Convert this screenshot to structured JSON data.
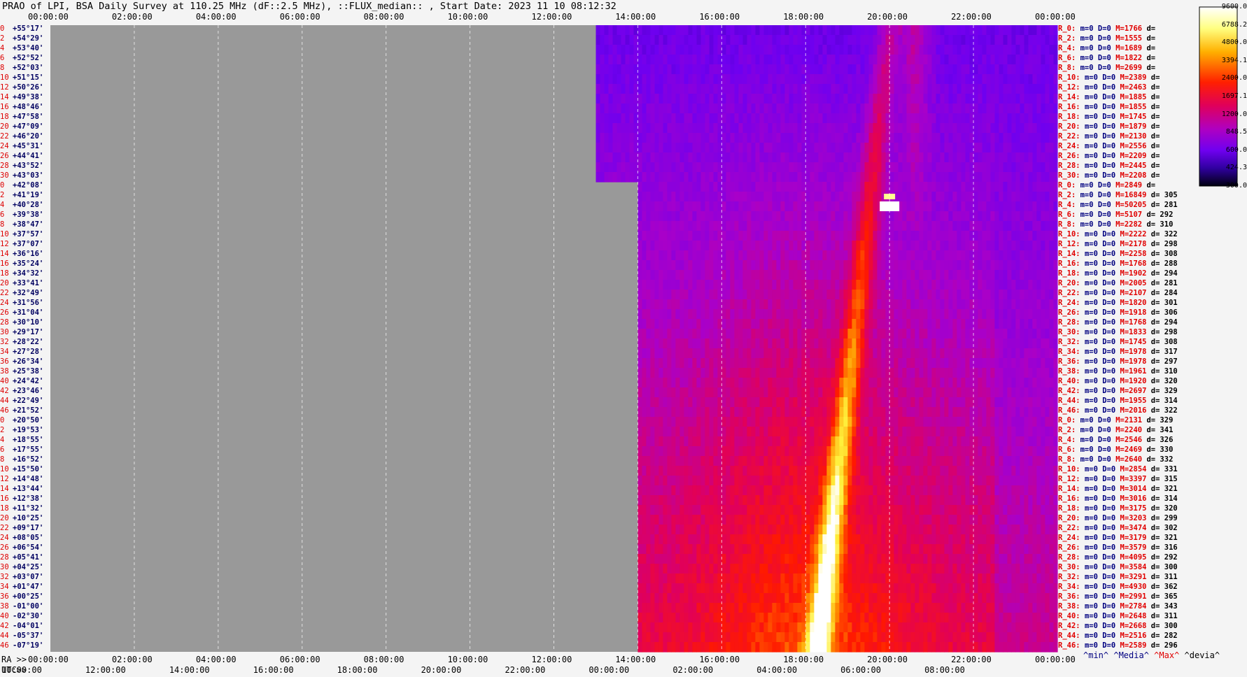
{
  "title": "PRAO of LPI, BSA Daily Survey at 110.25 MHz (dF::2.5 MHz), ::FLUX_median:: , Start Date: 2023 11 10 08:12:32",
  "footer": {
    "ra_prefix": "RA >>",
    "utc_prefix": "UTC>>"
  },
  "legend": {
    "min": "^min^",
    "median": "^Media^",
    "max": "^Max^",
    "devia": "^devia^"
  },
  "colors": {
    "background": "#999999",
    "panel": "#f4f4f4",
    "grid": "#ffffff"
  },
  "chart_data": {
    "type": "heatmap",
    "title": "PRAO of LPI, BSA Daily Survey at 110.25 MHz (dF::2.5 MHz), ::FLUX_median:: , Start Date: 2023 11 10 08:12:32",
    "x_range_hours": [
      0,
      24
    ],
    "data_start_hours": 14.0,
    "data_start_hours_upper_block": 13.0,
    "upper_block_rows": 16,
    "top_ticks": [
      "00:00:00",
      "02:00:00",
      "04:00:00",
      "06:00:00",
      "08:00:00",
      "10:00:00",
      "12:00:00",
      "14:00:00",
      "16:00:00",
      "18:00:00",
      "20:00:00",
      "22:00:00",
      "00:00:00"
    ],
    "bottom_ra_ticks": [
      "00:00:00",
      "02:00:00",
      "04:00:00",
      "06:00:00",
      "08:00:00",
      "10:00:00",
      "12:00:00",
      "14:00:00",
      "16:00:00",
      "18:00:00",
      "20:00:00",
      "22:00:00",
      "00:00:00"
    ],
    "bottom_utc_ticks": [
      "10:00:00",
      "12:00:00",
      "14:00:00",
      "16:00:00",
      "18:00:00",
      "20:00:00",
      "22:00:00",
      "00:00:00",
      "02:00:00",
      "04:00:00",
      "06:00:00",
      "08:00:00"
    ],
    "colorbar": {
      "labels": [
        "9600.0",
        "6788.2",
        "4800.0",
        "3394.1",
        "2400.0",
        "1697.1",
        "1200.0",
        "848.5",
        "600.0",
        "424.3",
        "300.0"
      ]
    },
    "rows": [
      {
        "i": "0",
        "dec": "+55°17'",
        "r": "R_0:",
        "m": "0",
        "D": "0",
        "M": "1766",
        "d": ""
      },
      {
        "i": "2",
        "dec": "+54°29'",
        "r": "R_2:",
        "m": "0",
        "D": "0",
        "M": "1555",
        "d": ""
      },
      {
        "i": "4",
        "dec": "+53°40'",
        "r": "R_4:",
        "m": "0",
        "D": "0",
        "M": "1689",
        "d": ""
      },
      {
        "i": "6",
        "dec": "+52°52'",
        "r": "R_6:",
        "m": "0",
        "D": "0",
        "M": "1822",
        "d": ""
      },
      {
        "i": "8",
        "dec": "+52°03'",
        "r": "R_8:",
        "m": "0",
        "D": "0",
        "M": "2699",
        "d": ""
      },
      {
        "i": "10",
        "dec": "+51°15'",
        "r": "R_10:",
        "m": "0",
        "D": "0",
        "M": "2389",
        "d": ""
      },
      {
        "i": "12",
        "dec": "+50°26'",
        "r": "R_12:",
        "m": "0",
        "D": "0",
        "M": "2463",
        "d": ""
      },
      {
        "i": "14",
        "dec": "+49°38'",
        "r": "R_14:",
        "m": "0",
        "D": "0",
        "M": "1885",
        "d": ""
      },
      {
        "i": "16",
        "dec": "+48°46'",
        "r": "R_16:",
        "m": "0",
        "D": "0",
        "M": "1855",
        "d": ""
      },
      {
        "i": "18",
        "dec": "+47°58'",
        "r": "R_18:",
        "m": "0",
        "D": "0",
        "M": "1745",
        "d": ""
      },
      {
        "i": "20",
        "dec": "+47°09'",
        "r": "R_20:",
        "m": "0",
        "D": "0",
        "M": "1879",
        "d": ""
      },
      {
        "i": "22",
        "dec": "+46°20'",
        "r": "R_22:",
        "m": "0",
        "D": "0",
        "M": "2130",
        "d": ""
      },
      {
        "i": "24",
        "dec": "+45°31'",
        "r": "R_24:",
        "m": "0",
        "D": "0",
        "M": "2556",
        "d": ""
      },
      {
        "i": "26",
        "dec": "+44°41'",
        "r": "R_26:",
        "m": "0",
        "D": "0",
        "M": "2209",
        "d": ""
      },
      {
        "i": "28",
        "dec": "+43°52'",
        "r": "R_28:",
        "m": "0",
        "D": "0",
        "M": "2445",
        "d": ""
      },
      {
        "i": "30",
        "dec": "+43°03'",
        "r": "R_30:",
        "m": "0",
        "D": "0",
        "M": "2208",
        "d": ""
      },
      {
        "i": "0",
        "dec": "+42°08'",
        "r": "R_0:",
        "m": "0",
        "D": "0",
        "M": "2849",
        "d": ""
      },
      {
        "i": "2",
        "dec": "+41°19'",
        "r": "R_2:",
        "m": "0",
        "D": "0",
        "M": "16849",
        "d": "305"
      },
      {
        "i": "4",
        "dec": "+40°28'",
        "r": "R_4:",
        "m": "0",
        "D": "0",
        "M": "50205",
        "d": "281"
      },
      {
        "i": "6",
        "dec": "+39°38'",
        "r": "R_6:",
        "m": "0",
        "D": "0",
        "M": "5107",
        "d": "292"
      },
      {
        "i": "8",
        "dec": "+38°47'",
        "r": "R_8:",
        "m": "0",
        "D": "0",
        "M": "2282",
        "d": "310"
      },
      {
        "i": "10",
        "dec": "+37°57'",
        "r": "R_10:",
        "m": "0",
        "D": "0",
        "M": "2222",
        "d": "322"
      },
      {
        "i": "12",
        "dec": "+37°07'",
        "r": "R_12:",
        "m": "0",
        "D": "0",
        "M": "2178",
        "d": "298"
      },
      {
        "i": "14",
        "dec": "+36°16'",
        "r": "R_14:",
        "m": "0",
        "D": "0",
        "M": "2258",
        "d": "308"
      },
      {
        "i": "16",
        "dec": "+35°24'",
        "r": "R_16:",
        "m": "0",
        "D": "0",
        "M": "1768",
        "d": "288"
      },
      {
        "i": "18",
        "dec": "+34°32'",
        "r": "R_18:",
        "m": "0",
        "D": "0",
        "M": "1902",
        "d": "294"
      },
      {
        "i": "20",
        "dec": "+33°41'",
        "r": "R_20:",
        "m": "0",
        "D": "0",
        "M": "2005",
        "d": "281"
      },
      {
        "i": "22",
        "dec": "+32°49'",
        "r": "R_22:",
        "m": "0",
        "D": "0",
        "M": "2107",
        "d": "284"
      },
      {
        "i": "24",
        "dec": "+31°56'",
        "r": "R_24:",
        "m": "0",
        "D": "0",
        "M": "1820",
        "d": "301"
      },
      {
        "i": "26",
        "dec": "+31°04'",
        "r": "R_26:",
        "m": "0",
        "D": "0",
        "M": "1918",
        "d": "306"
      },
      {
        "i": "28",
        "dec": "+30°10'",
        "r": "R_28:",
        "m": "0",
        "D": "0",
        "M": "1768",
        "d": "294"
      },
      {
        "i": "30",
        "dec": "+29°17'",
        "r": "R_30:",
        "m": "0",
        "D": "0",
        "M": "1833",
        "d": "298"
      },
      {
        "i": "32",
        "dec": "+28°22'",
        "r": "R_32:",
        "m": "0",
        "D": "0",
        "M": "1745",
        "d": "308"
      },
      {
        "i": "34",
        "dec": "+27°28'",
        "r": "R_34:",
        "m": "0",
        "D": "0",
        "M": "1978",
        "d": "317"
      },
      {
        "i": "36",
        "dec": "+26°34'",
        "r": "R_36:",
        "m": "0",
        "D": "0",
        "M": "1978",
        "d": "297"
      },
      {
        "i": "38",
        "dec": "+25°38'",
        "r": "R_38:",
        "m": "0",
        "D": "0",
        "M": "1961",
        "d": "310"
      },
      {
        "i": "40",
        "dec": "+24°42'",
        "r": "R_40:",
        "m": "0",
        "D": "0",
        "M": "1920",
        "d": "320"
      },
      {
        "i": "42",
        "dec": "+23°46'",
        "r": "R_42:",
        "m": "0",
        "D": "0",
        "M": "2697",
        "d": "329"
      },
      {
        "i": "44",
        "dec": "+22°49'",
        "r": "R_44:",
        "m": "0",
        "D": "0",
        "M": "1955",
        "d": "314"
      },
      {
        "i": "46",
        "dec": "+21°52'",
        "r": "R_46:",
        "m": "0",
        "D": "0",
        "M": "2016",
        "d": "322"
      },
      {
        "i": "0",
        "dec": "+20°50'",
        "r": "R_0:",
        "m": "0",
        "D": "0",
        "M": "2131",
        "d": "329"
      },
      {
        "i": "2",
        "dec": "+19°53'",
        "r": "R_2:",
        "m": "0",
        "D": "0",
        "M": "2240",
        "d": "341"
      },
      {
        "i": "4",
        "dec": "+18°55'",
        "r": "R_4:",
        "m": "0",
        "D": "0",
        "M": "2546",
        "d": "326"
      },
      {
        "i": "6",
        "dec": "+17°55'",
        "r": "R_6:",
        "m": "0",
        "D": "0",
        "M": "2469",
        "d": "330"
      },
      {
        "i": "8",
        "dec": "+16°52'",
        "r": "R_8:",
        "m": "0",
        "D": "0",
        "M": "2640",
        "d": "332"
      },
      {
        "i": "10",
        "dec": "+15°50'",
        "r": "R_10:",
        "m": "0",
        "D": "0",
        "M": "2854",
        "d": "331"
      },
      {
        "i": "12",
        "dec": "+14°48'",
        "r": "R_12:",
        "m": "0",
        "D": "0",
        "M": "3397",
        "d": "315"
      },
      {
        "i": "14",
        "dec": "+13°44'",
        "r": "R_14:",
        "m": "0",
        "D": "0",
        "M": "3014",
        "d": "321"
      },
      {
        "i": "16",
        "dec": "+12°38'",
        "r": "R_16:",
        "m": "0",
        "D": "0",
        "M": "3016",
        "d": "314"
      },
      {
        "i": "18",
        "dec": "+11°32'",
        "r": "R_18:",
        "m": "0",
        "D": "0",
        "M": "3175",
        "d": "320"
      },
      {
        "i": "20",
        "dec": "+10°25'",
        "r": "R_20:",
        "m": "0",
        "D": "0",
        "M": "3203",
        "d": "299"
      },
      {
        "i": "22",
        "dec": "+09°17'",
        "r": "R_22:",
        "m": "0",
        "D": "0",
        "M": "3474",
        "d": "302"
      },
      {
        "i": "24",
        "dec": "+08°05'",
        "r": "R_24:",
        "m": "0",
        "D": "0",
        "M": "3179",
        "d": "321"
      },
      {
        "i": "26",
        "dec": "+06°54'",
        "r": "R_26:",
        "m": "0",
        "D": "0",
        "M": "3579",
        "d": "316"
      },
      {
        "i": "28",
        "dec": "+05°41'",
        "r": "R_28:",
        "m": "0",
        "D": "0",
        "M": "4095",
        "d": "292"
      },
      {
        "i": "30",
        "dec": "+04°25'",
        "r": "R_30:",
        "m": "0",
        "D": "0",
        "M": "3584",
        "d": "300"
      },
      {
        "i": "32",
        "dec": "+03°07'",
        "r": "R_32:",
        "m": "0",
        "D": "0",
        "M": "3291",
        "d": "311"
      },
      {
        "i": "34",
        "dec": "+01°47'",
        "r": "R_34:",
        "m": "0",
        "D": "0",
        "M": "4930",
        "d": "362"
      },
      {
        "i": "36",
        "dec": "+00°25'",
        "r": "R_36:",
        "m": "0",
        "D": "0",
        "M": "2991",
        "d": "365"
      },
      {
        "i": "38",
        "dec": "-01°00'",
        "r": "R_38:",
        "m": "0",
        "D": "0",
        "M": "2784",
        "d": "343"
      },
      {
        "i": "40",
        "dec": "-02°30'",
        "r": "R_40:",
        "m": "0",
        "D": "0",
        "M": "2648",
        "d": "311"
      },
      {
        "i": "42",
        "dec": "-04°01'",
        "r": "R_42:",
        "m": "0",
        "D": "0",
        "M": "2668",
        "d": "300"
      },
      {
        "i": "44",
        "dec": "-05°37'",
        "r": "R_44:",
        "m": "0",
        "D": "0",
        "M": "2516",
        "d": "282"
      },
      {
        "i": "46",
        "dec": "-07°19'",
        "r": "R_46:",
        "m": "0",
        "D": "0",
        "M": "2589",
        "d": "296"
      }
    ]
  }
}
